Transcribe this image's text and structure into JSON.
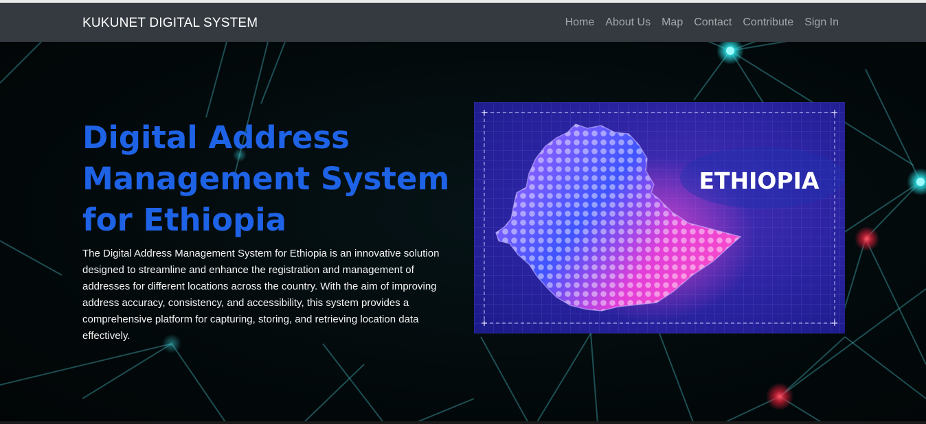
{
  "navbar": {
    "brand": "KUKUNET DIGITAL SYSTEM",
    "links": [
      "Home",
      "About Us",
      "Map",
      "Contact",
      "Contribute",
      "Sign In"
    ]
  },
  "hero": {
    "title": "Digital Address Management System for Ethiopia",
    "description": "The Digital Address Management System for Ethiopia is an innovative solution designed to streamline and enhance the registration and management of addresses for different locations across the country. With the aim of improving address accuracy, consistency, and accessibility, this system provides a comprehensive platform for capturing, storing, and retrieving location data effectively.",
    "image": {
      "label": "ETHIOPIA",
      "icon": "ethiopia-map-icon"
    }
  },
  "colors": {
    "navbar_bg": "#343a40",
    "title": "#1e62e6",
    "hero_bg": "#02090b",
    "image_bg": "#1c1b8a",
    "network_cyan": "#2de3e8",
    "network_red": "#e0203a"
  }
}
